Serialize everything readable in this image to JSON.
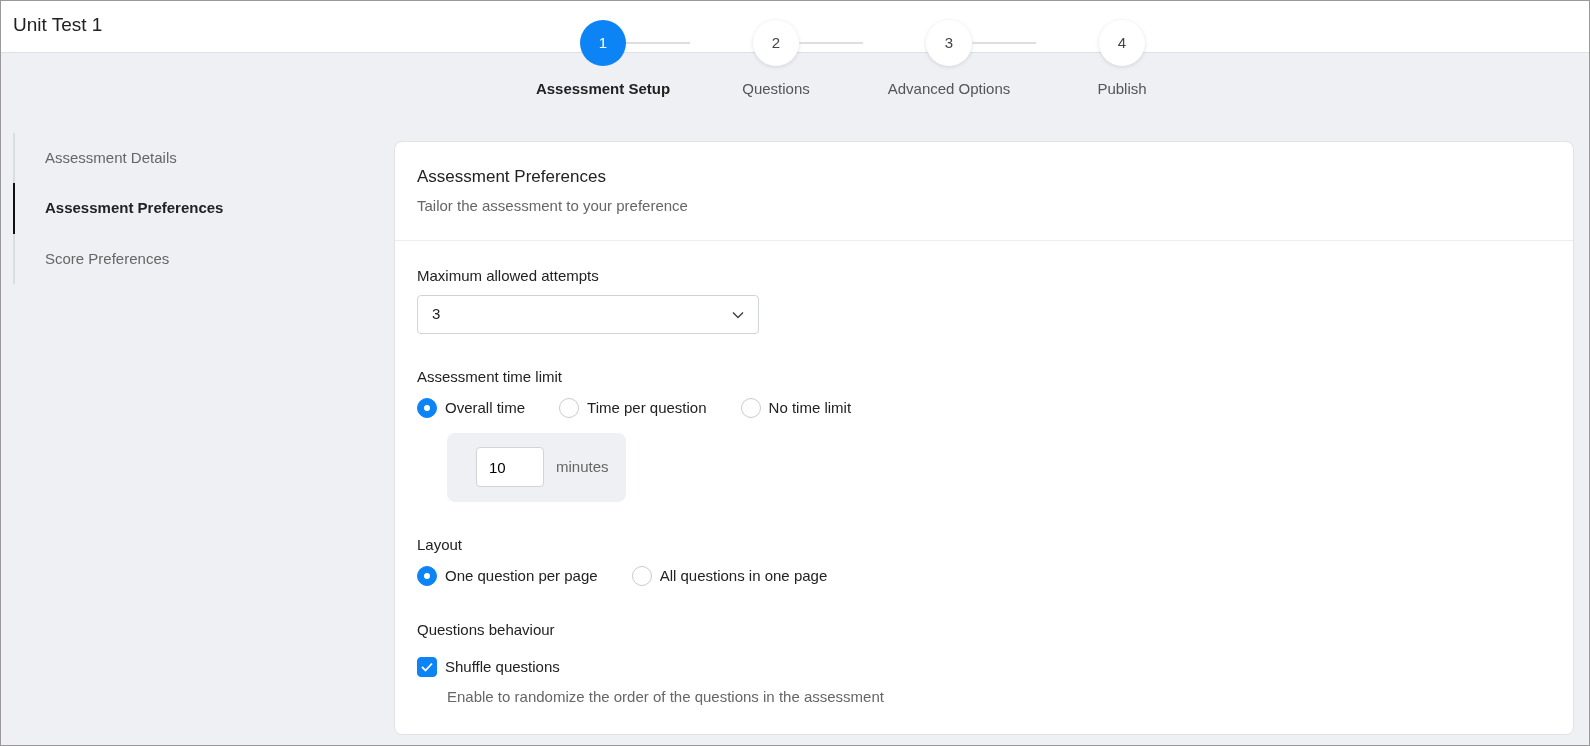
{
  "window": {
    "title": "Unit Test 1"
  },
  "steps": [
    {
      "number": "1",
      "label": "Assessment Setup",
      "selected": true
    },
    {
      "number": "2",
      "label": "Questions",
      "selected": false
    },
    {
      "number": "3",
      "label": "Advanced Options",
      "selected": false
    },
    {
      "number": "4",
      "label": "Publish",
      "selected": false
    }
  ],
  "sidebar": {
    "items": [
      {
        "label": "Assessment Details",
        "selected": false
      },
      {
        "label": "Assessment Preferences",
        "selected": true
      },
      {
        "label": "Score Preferences",
        "selected": false
      }
    ]
  },
  "panel": {
    "title": "Assessment Preferences",
    "subtitle": "Tailor the assessment to your preference",
    "attempts": {
      "label": "Maximum allowed attempts",
      "value": "3"
    },
    "time_limit": {
      "label": "Assessment time limit",
      "options": [
        {
          "label": "Overall time",
          "selected": true
        },
        {
          "label": "Time per question",
          "selected": false
        },
        {
          "label": "No time limit",
          "selected": false
        }
      ],
      "minutes_value": "10",
      "minutes_unit": "minutes"
    },
    "layout": {
      "label": "Layout",
      "options": [
        {
          "label": "One question per page",
          "selected": true
        },
        {
          "label": "All questions in one page",
          "selected": false
        }
      ]
    },
    "behaviour": {
      "label": "Questions behaviour",
      "checkbox": {
        "label": "Shuffle questions",
        "checked": true,
        "help": "Enable to randomize the order of the questions in the assessment"
      }
    }
  }
}
